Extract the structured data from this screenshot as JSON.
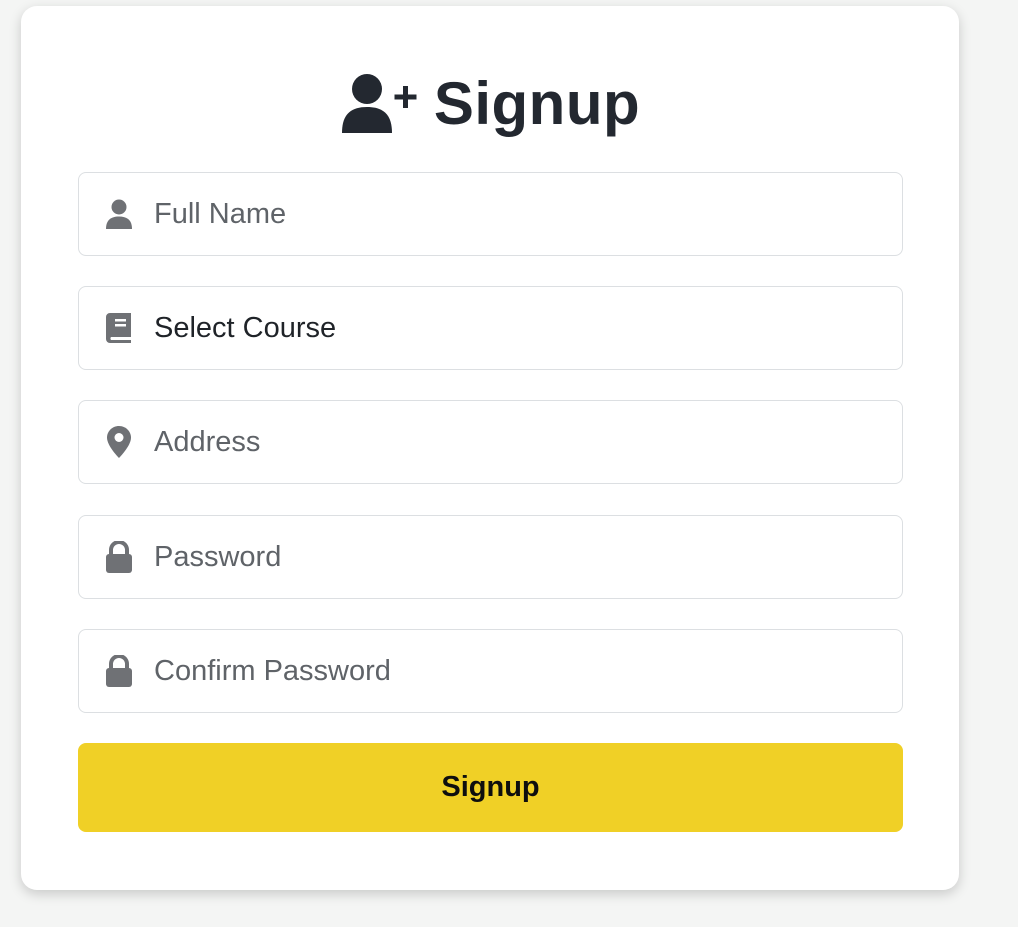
{
  "form": {
    "title": "Signup",
    "title_icon": "user-plus-icon",
    "fields": [
      {
        "icon": "user-icon",
        "placeholder": "Full Name",
        "value": ""
      },
      {
        "icon": "book-icon",
        "selected": "Select Course"
      },
      {
        "icon": "map-marker-icon",
        "placeholder": "Address",
        "value": ""
      },
      {
        "icon": "lock-icon",
        "placeholder": "Password",
        "value": ""
      },
      {
        "icon": "lock-icon",
        "placeholder": "Confirm Password",
        "value": ""
      }
    ],
    "submit_label": "Signup"
  },
  "colors": {
    "accent": "#f0d026",
    "icon": "#6f7175",
    "title": "#232830",
    "background": "#f4f5f4"
  }
}
